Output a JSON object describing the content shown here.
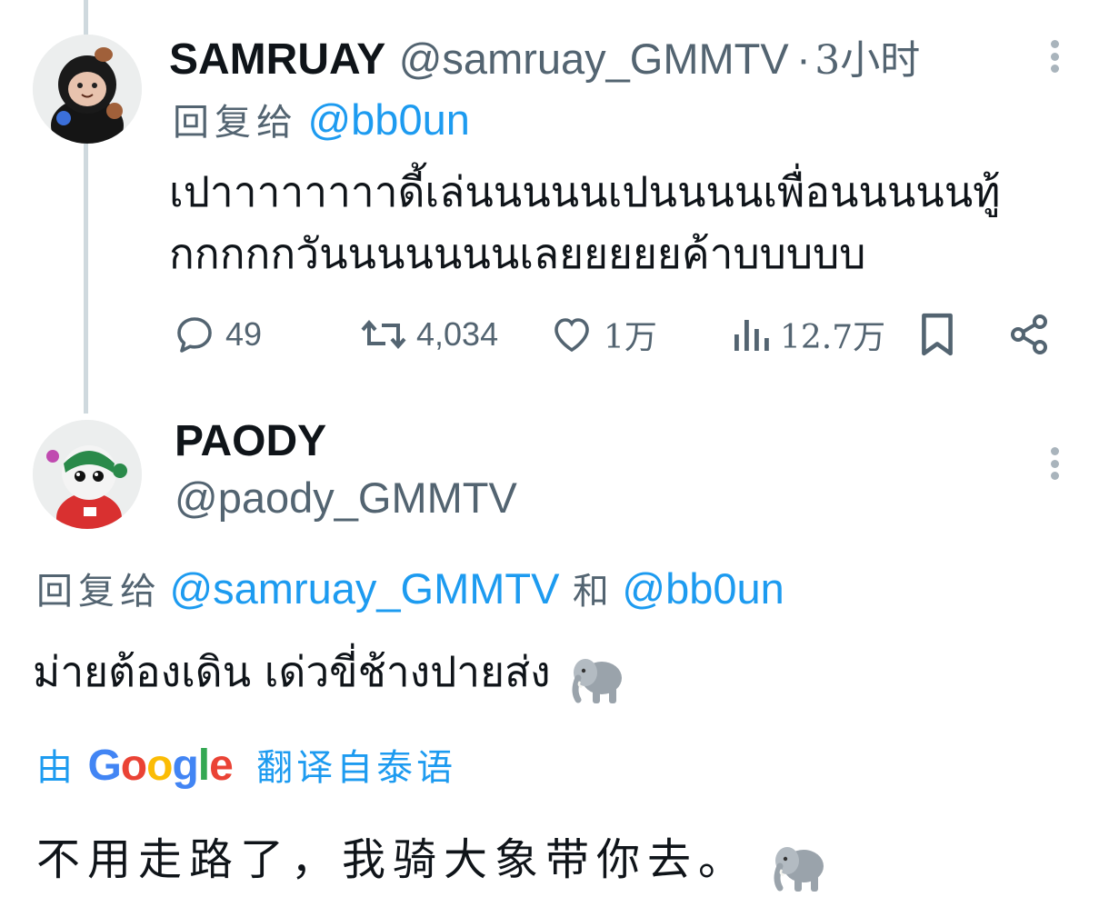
{
  "tweet1": {
    "name": "SAMRUAY",
    "handle": "@samruay_GMMTV",
    "separator": "·",
    "time": "3小时",
    "reply_prefix": "回复给",
    "reply_to": "@bb0un",
    "text_line1": "เปาาาาาาาาดี้เล่นนนนนเปนนนนเพื่อนนนนนทู้",
    "text_line2": "กกกกกวันนนนนนนเลยยยยยค้าบบบบบ",
    "replies": "49",
    "retweets": "4,034",
    "likes": "1万",
    "views": "12.7万"
  },
  "tweet2": {
    "name": "PAODY",
    "handle": "@paody_GMMTV",
    "reply_prefix": "回复给",
    "reply_to_1": "@samruay_GMMTV",
    "reply_and": "和",
    "reply_to_2": "@bb0un",
    "text": "ม่ายต้องเดิน เด่วขี่ช้างปายส่ง",
    "translate_prefix": "由",
    "translate_brand": "Google",
    "translate_suffix": "翻译自泰语",
    "translation": "不用走路了，我骑大象带你去。"
  },
  "icons": {
    "reply": "reply-icon",
    "retweet": "retweet-icon",
    "like": "heart-icon",
    "views": "views-icon",
    "bookmark": "bookmark-icon",
    "share": "share-icon",
    "more": "more-icon",
    "emoji": "elephant-emoji"
  },
  "colors": {
    "link": "#1d9bf0",
    "secondary": "#536471",
    "text": "#0f1419",
    "thread_line": "#cfd9de"
  }
}
